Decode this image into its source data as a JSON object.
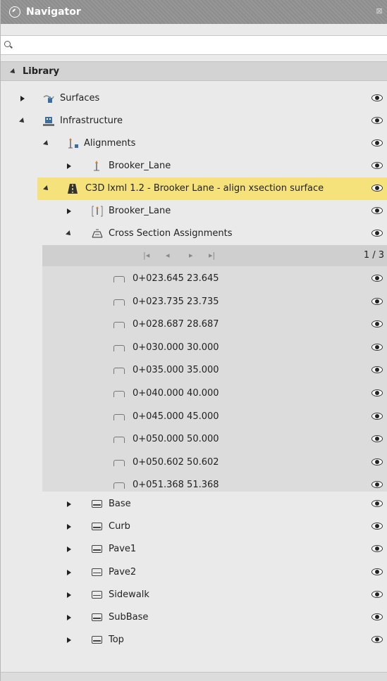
{
  "window": {
    "title": "Navigator",
    "close_label": "⊠"
  },
  "search": {
    "placeholder": "",
    "value": ""
  },
  "library": {
    "label": "Library"
  },
  "tree": {
    "surfaces": "Surfaces",
    "infrastructure": "Infrastructure",
    "alignments": "Alignments",
    "alignment_item": "Brooker_Lane",
    "model": "C3D lxml 1.2 - Brooker Lane - align xsection surface",
    "model_alignment": "Brooker_Lane",
    "cross_sections": "Cross Section Assignments",
    "pager": {
      "first": "|◂",
      "prev": "◂",
      "next": "▸",
      "last": "▸|",
      "page": "1 / 3"
    },
    "stations": [
      "0+023.645 23.645",
      "0+023.735 23.735",
      "0+028.687 28.687",
      "0+030.000 30.000",
      "0+035.000 35.000",
      "0+040.000 40.000",
      "0+045.000 45.000",
      "0+050.000 50.000",
      "0+050.602 50.602",
      "0+051.368 51.368"
    ],
    "layers": [
      "Base",
      "Curb",
      "Pave1",
      "Pave2",
      "Sidewalk",
      "SubBase",
      "Top"
    ]
  },
  "colors": {
    "highlight": "#f5e27a",
    "titlebar": "#939393"
  }
}
